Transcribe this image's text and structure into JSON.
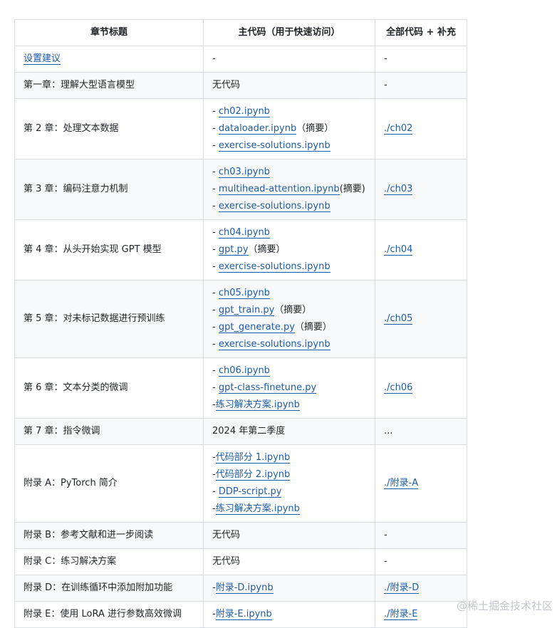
{
  "headers": [
    "章节标题",
    "主代码（用于快速访问）",
    "全部代码 + 补充"
  ],
  "link_color": "#1e5ba6",
  "rows": [
    {
      "cells": [
        [
          [
            {
              "t": "设置建议",
              "link": true
            }
          ]
        ],
        [
          [
            {
              "t": "-"
            }
          ]
        ],
        [
          [
            {
              "t": "-"
            }
          ]
        ]
      ]
    },
    {
      "cells": [
        [
          [
            {
              "t": "第一章：理解大型语言模型"
            }
          ]
        ],
        [
          [
            {
              "t": "无代码"
            }
          ]
        ],
        [
          [
            {
              "t": "-"
            }
          ]
        ]
      ]
    },
    {
      "cells": [
        [
          [
            {
              "t": "第 2 章：处理文本数据"
            }
          ]
        ],
        [
          [
            {
              "t": "- "
            },
            {
              "t": "ch02.ipynb",
              "link": true
            }
          ],
          [
            {
              "t": "- "
            },
            {
              "t": "dataloader.ipynb",
              "link": true
            },
            {
              "t": "（摘要）"
            }
          ],
          [
            {
              "t": "- "
            },
            {
              "t": "exercise-solutions.ipynb",
              "link": true
            }
          ]
        ],
        [
          [
            {
              "t": "./ch02",
              "link": true
            }
          ]
        ]
      ]
    },
    {
      "cells": [
        [
          [
            {
              "t": "第 3 章：编码注意力机制"
            }
          ]
        ],
        [
          [
            {
              "t": "- "
            },
            {
              "t": "ch03.ipynb",
              "link": true
            }
          ],
          [
            {
              "t": "- "
            },
            {
              "t": "multihead-attention.ipynb",
              "link": true
            },
            {
              "t": "(摘要)"
            }
          ],
          [
            {
              "t": "- "
            },
            {
              "t": "exercise-solutions.ipynb",
              "link": true
            }
          ]
        ],
        [
          [
            {
              "t": "./ch03",
              "link": true
            }
          ]
        ]
      ]
    },
    {
      "cells": [
        [
          [
            {
              "t": "第 4 章：从头开始实现 GPT 模型"
            }
          ]
        ],
        [
          [
            {
              "t": "- "
            },
            {
              "t": "ch04.ipynb",
              "link": true
            }
          ],
          [
            {
              "t": "- "
            },
            {
              "t": "gpt.py",
              "link": true
            },
            {
              "t": "（摘要）"
            }
          ],
          [
            {
              "t": "- "
            },
            {
              "t": "exercise-solutions.ipynb",
              "link": true
            }
          ]
        ],
        [
          [
            {
              "t": "./ch04",
              "link": true
            }
          ]
        ]
      ]
    },
    {
      "cells": [
        [
          [
            {
              "t": "第 5 章：对未标记数据进行预训练"
            }
          ]
        ],
        [
          [
            {
              "t": "- "
            },
            {
              "t": "ch05.ipynb",
              "link": true
            }
          ],
          [
            {
              "t": "- "
            },
            {
              "t": "gpt_train.py",
              "link": true
            },
            {
              "t": "（摘要）"
            }
          ],
          [
            {
              "t": "- "
            },
            {
              "t": "gpt_generate.py",
              "link": true
            },
            {
              "t": "（摘要）"
            }
          ],
          [
            {
              "t": "- "
            },
            {
              "t": "exercise-solutions.ipynb",
              "link": true
            }
          ]
        ],
        [
          [
            {
              "t": "./ch05",
              "link": true
            }
          ]
        ]
      ]
    },
    {
      "cells": [
        [
          [
            {
              "t": "第 6 章：文本分类的微调"
            }
          ]
        ],
        [
          [
            {
              "t": "- "
            },
            {
              "t": "ch06.ipynb",
              "link": true
            }
          ],
          [
            {
              "t": "- "
            },
            {
              "t": "gpt-class-finetune.py",
              "link": true
            }
          ],
          [
            {
              "t": "-"
            },
            {
              "t": "练习解决方案.ipynb",
              "link": true
            }
          ]
        ],
        [
          [
            {
              "t": "./ch06",
              "link": true
            }
          ]
        ]
      ]
    },
    {
      "cells": [
        [
          [
            {
              "t": "第 7 章：指令微调"
            }
          ]
        ],
        [
          [
            {
              "t": "2024 年第二季度"
            }
          ]
        ],
        [
          [
            {
              "t": "..."
            }
          ]
        ]
      ]
    },
    {
      "cells": [
        [
          [
            {
              "t": "附录 A：PyTorch 简介"
            }
          ]
        ],
        [
          [
            {
              "t": "-"
            },
            {
              "t": "代码部分 1.ipynb",
              "link": true
            }
          ],
          [
            {
              "t": "-"
            },
            {
              "t": "代码部分 2.ipynb",
              "link": true
            }
          ],
          [
            {
              "t": "- "
            },
            {
              "t": "DDP-script.py",
              "link": true
            }
          ],
          [
            {
              "t": "-"
            },
            {
              "t": "练习解决方案.ipynb",
              "link": true
            }
          ]
        ],
        [
          [
            {
              "t": "./附录-A",
              "link": true
            }
          ]
        ]
      ]
    },
    {
      "cells": [
        [
          [
            {
              "t": "附录 B：参考文献和进一步阅读"
            }
          ]
        ],
        [
          [
            {
              "t": "无代码"
            }
          ]
        ],
        [
          [
            {
              "t": "-"
            }
          ]
        ]
      ]
    },
    {
      "cells": [
        [
          [
            {
              "t": "附录 C：练习解决方案"
            }
          ]
        ],
        [
          [
            {
              "t": "无代码"
            }
          ]
        ],
        [
          [
            {
              "t": "-"
            }
          ]
        ]
      ]
    },
    {
      "cells": [
        [
          [
            {
              "t": "附录 D：在训练循环中添加附加功能"
            }
          ]
        ],
        [
          [
            {
              "t": "-"
            },
            {
              "t": "附录-D.ipynb",
              "link": true
            }
          ]
        ],
        [
          [
            {
              "t": "./附录-D",
              "link": true
            }
          ]
        ]
      ]
    },
    {
      "cells": [
        [
          [
            {
              "t": "附录 E：使用 LoRA 进行参数高效微调"
            }
          ]
        ],
        [
          [
            {
              "t": "-"
            },
            {
              "t": "附录-E.ipynb",
              "link": true
            }
          ]
        ],
        [
          [
            {
              "t": "./附录-E",
              "link": true
            }
          ]
        ]
      ]
    }
  ],
  "watermark": "@稀土掘金技术社区"
}
